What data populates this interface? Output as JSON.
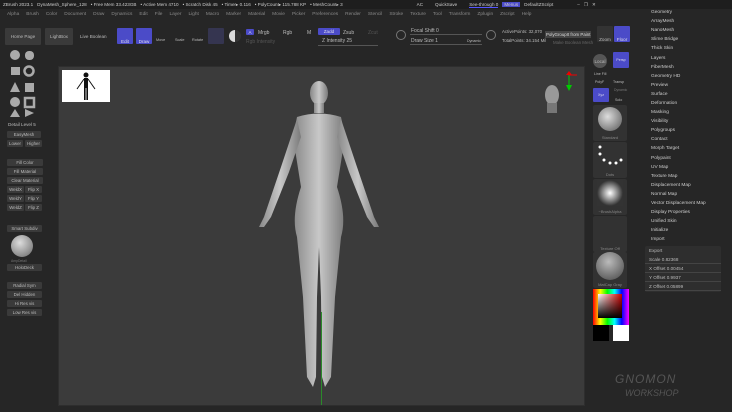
{
  "title_bar": {
    "app": "ZBrush 2023.1",
    "doc": "DynaMesh_Sphere_128",
    "free_mem": "• Free Mem 33.423GB",
    "active_mem": "• Active Mem 4710",
    "scratch": "• Scratch Disk 45",
    "timer": "• Timer▸ 0.116",
    "polycount": "• PolyCount▸ 115.788 KP",
    "meshcount": "• MeshCount▸ 3",
    "ac": "AC",
    "quicksave": "QuickSave",
    "see_through": "See-through 0",
    "menus": "Menus",
    "default_zscript": "DefaultZScript"
  },
  "menu": [
    "Alpha",
    "Brush",
    "Color",
    "Document",
    "Draw",
    "Dynamics",
    "Edit",
    "File",
    "Layer",
    "Light",
    "Macro",
    "Marker",
    "Material",
    "Movie",
    "Picker",
    "Preferences",
    "Render",
    "Stencil",
    "Stroke",
    "Texture",
    "Tool",
    "Transform",
    "Zplugin",
    "Zscript",
    "Help"
  ],
  "toolbar": {
    "home": "Home Page",
    "lightbox": "LightBox",
    "live_boolean": "Live Boolean",
    "edit": "Edit",
    "draw": "Draw",
    "move": "Move",
    "scale": "Scale",
    "rotate": "Rotate",
    "a": "A",
    "mrgb": "Mrgb",
    "rgb": "Rgb",
    "m": "M",
    "rgb_intensity": "Rgb Intensity",
    "zadd": "Zadd",
    "zsub": "Zsub",
    "zcut": "Zcut",
    "z_intensity": "Z Intensity 25",
    "focal_shift": "Focal Shift 0",
    "draw_size": "Draw Size 1",
    "dynamic": "Dynamic",
    "active_points": "ActivePoints: 32,070",
    "total_points": "TotalPoints: 34.154 Mil",
    "polygroup_tip": "PolyGroupIt from Paint",
    "make_boolean": "Make Boolean Mesh",
    "zoom": "Zoom",
    "floor": "Floor",
    "zoom_value": 0.25
  },
  "left_panel": {
    "detail_level": "Detail Level 5",
    "easymesh": "EasyMesh",
    "lower": "Lower",
    "higher": "Higher",
    "fill_color": "Fill Color",
    "fill_material": "Fill Material",
    "clear_material": "Clear Material",
    "weldx": "WeldX",
    "flipx": "Flip X",
    "weldy": "WeldY",
    "flipy": "Flip Y",
    "weldz": "WeldZ",
    "flipz": "Flip Z",
    "smart_subdiv": "Smart Subdiv",
    "amp": "AmpDetail",
    "holodeck": "HoloDeck",
    "radial_sym": "Radial Sym",
    "del_hidden": "Del Hidden",
    "hi_res": "Hi Res vis",
    "low_res": "Low Res vis"
  },
  "right_tools": {
    "local": "Local",
    "persp": "Persp",
    "line_fill": "Line Fill",
    "polyf": "PolyF",
    "transp": "Transp",
    "dynamic": "Dynamic",
    "solo": "Solo",
    "xyz": "Xyz",
    "standard": "Standard",
    "dots": "Dots",
    "brush_alpha": "~BrushAlpha",
    "texture_off": "Texture Off",
    "matcap": "MatCap Gray"
  },
  "right_menu": [
    "Geometry",
    "ArrayMesh",
    "NanoMesh",
    "Slime Bridge",
    "Thick Skin",
    "Layers",
    "FiberMesh",
    "Geometry HD",
    "Preview",
    "Surface",
    "Deformation",
    "Masking",
    "Visibility",
    "Polygroups",
    "Contact",
    "Morph Target",
    "Polypaint",
    "UV Map",
    "Texture Map",
    "Displacement Map",
    "Normal Map",
    "Vector Displacement Map",
    "Display Properties",
    "Unified Skin",
    "Initialize",
    "Import"
  ],
  "export": {
    "title": "Export",
    "scale": "Scale 0.82368",
    "x": "X Offset 0.00454",
    "y": "Y Offset 0.9937",
    "z": "Z Offset 0.05899"
  },
  "watermark": "THE GNOMON WORKSHOP",
  "colors": {
    "accent": "#4b4bc8",
    "bg": "#262626",
    "canvas": "#3b3b3b"
  }
}
